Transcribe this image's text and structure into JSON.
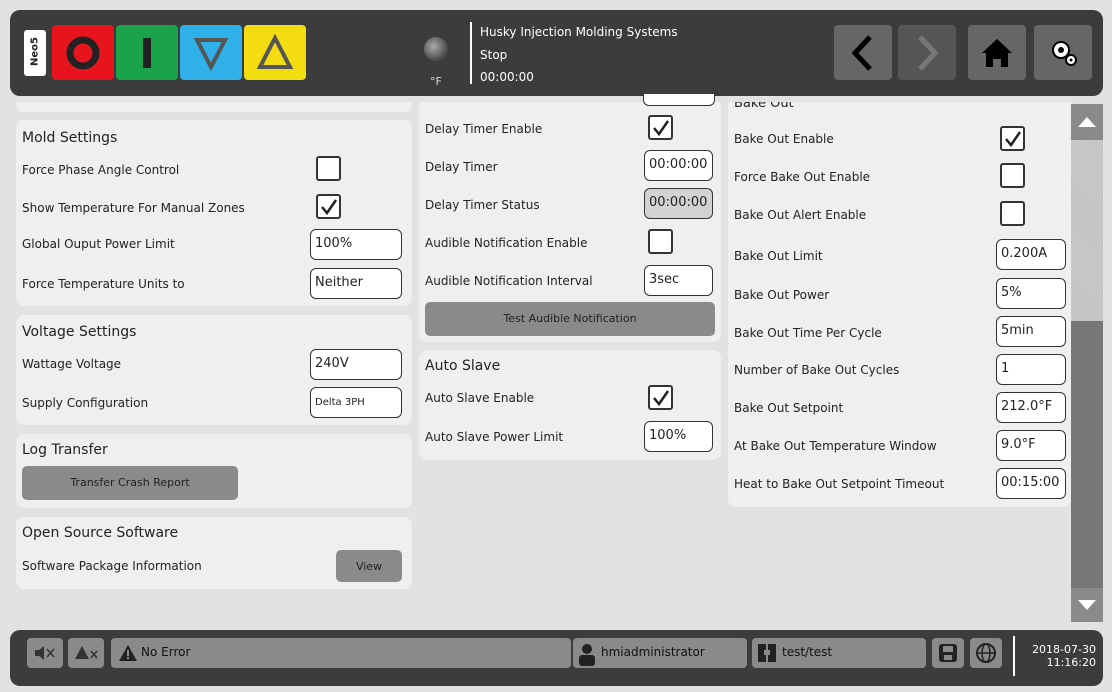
{
  "header": {
    "brand": "Neo5",
    "company": "Husky Injection Molding Systems",
    "status": "Stop",
    "time": "00:00:00",
    "units": "°F",
    "colors": {
      "stop": "#e8141d",
      "start": "#1aa34a",
      "down": "#2fb0e8",
      "up": "#f3dd10"
    }
  },
  "mold_settings": {
    "title": "Mold Settings",
    "force_phase_angle": "Force Phase Angle Control",
    "show_temp_manual": "Show Temperature For Manual Zones",
    "global_power_limit": "Global Ouput Power Limit",
    "global_power_limit_value": "100%",
    "force_temp_units": "Force Temperature Units to",
    "force_temp_units_value": "Neither"
  },
  "voltage_settings": {
    "title": "Voltage Settings",
    "wattage_voltage": "Wattage Voltage",
    "wattage_voltage_value": "240V",
    "supply_config": "Supply Configuration",
    "supply_config_value": "Delta 3PH"
  },
  "log_transfer": {
    "title": "Log Transfer",
    "button": "Transfer Crash Report"
  },
  "open_source": {
    "title": "Open Source Software",
    "label": "Software Package Information",
    "button": "View"
  },
  "alarms": {
    "delay_timer_enable": "Delay Timer Enable",
    "delay_timer": "Delay Timer",
    "delay_timer_value": "00:00:00",
    "delay_timer_status": "Delay Timer Status",
    "delay_timer_status_value": "00:00:00",
    "audible_enable": "Audible Notification Enable",
    "audible_interval": "Audible Notification Interval",
    "audible_interval_value": "3sec",
    "test_button": "Test Audible Notification"
  },
  "auto_slave": {
    "title": "Auto Slave",
    "enable": "Auto Slave Enable",
    "power_limit": "Auto Slave Power Limit",
    "power_limit_value": "100%"
  },
  "bake_out": {
    "title": "Bake Out",
    "enable": "Bake Out Enable",
    "force_enable": "Force Bake Out Enable",
    "alert_enable": "Bake Out Alert Enable",
    "limit": "Bake Out Limit",
    "limit_value": "0.200A",
    "power": "Bake Out Power",
    "power_value": "5%",
    "time_per_cycle": "Bake Out Time Per Cycle",
    "time_per_cycle_value": "5min",
    "cycles": "Number of Bake Out Cycles",
    "cycles_value": "1",
    "setpoint": "Bake Out Setpoint",
    "setpoint_value": "212.0°F",
    "temp_window": "At Bake Out Temperature Window",
    "temp_window_value": "9.0°F",
    "timeout": "Heat to Bake Out Setpoint Timeout",
    "timeout_value": "00:15:00"
  },
  "footer": {
    "error": "No Error",
    "user": "hmiadministrator",
    "mold": "test/test",
    "date": "2018-07-30",
    "clock": "11:16:20"
  }
}
